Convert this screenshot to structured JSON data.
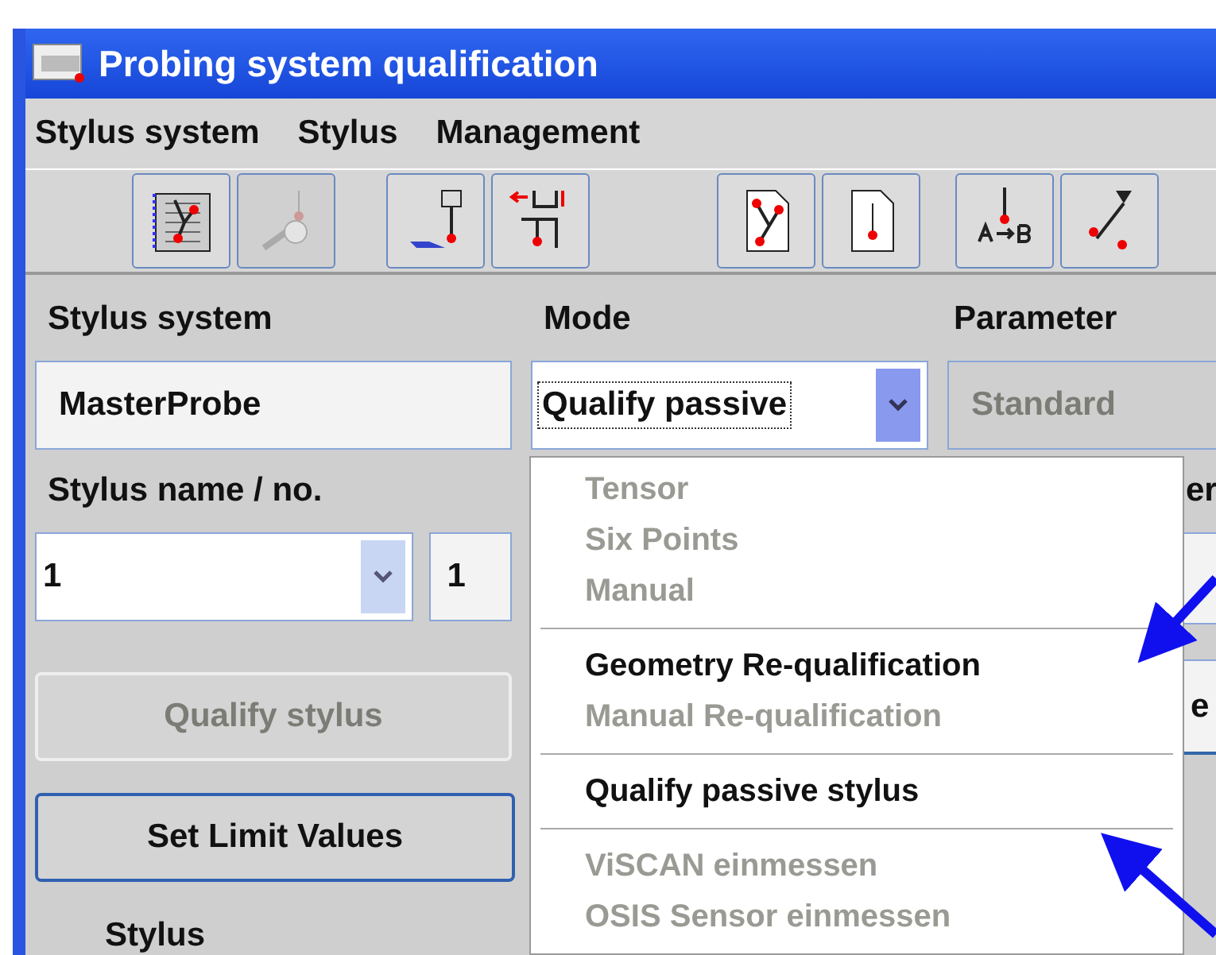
{
  "window": {
    "title": "Probing system qualification"
  },
  "menu": [
    "Stylus system",
    "Stylus",
    "Management"
  ],
  "toolbar": [
    {
      "kind": "stylus-board",
      "disabled": false
    },
    {
      "kind": "probe-ball",
      "disabled": true
    },
    {
      "kind": "hand-probe",
      "disabled": false
    },
    {
      "kind": "measure-probe",
      "disabled": false
    },
    {
      "kind": "page-multi",
      "disabled": false
    },
    {
      "kind": "page-single",
      "disabled": false
    },
    {
      "kind": "a-to-b",
      "disabled": false
    },
    {
      "kind": "tilt-probe",
      "disabled": false
    }
  ],
  "form": {
    "stylus_system": {
      "label": "Stylus system",
      "value": "MasterProbe"
    },
    "mode": {
      "label": "Mode",
      "value": "Qualify passive"
    },
    "parameter": {
      "label": "Parameter",
      "value": "Standard",
      "disabled": true
    },
    "stylus_name": {
      "label": "Stylus name / no.",
      "value": "1",
      "number": "1"
    },
    "column_3_label": "er",
    "column_3_button": "e",
    "stylus_label": "Stylus"
  },
  "mode_dropdown": [
    {
      "kind": "item",
      "label": "Tensor",
      "disabled": true
    },
    {
      "kind": "item",
      "label": "Six Points",
      "disabled": true
    },
    {
      "kind": "item",
      "label": "Manual",
      "disabled": true
    },
    {
      "kind": "separator"
    },
    {
      "kind": "item",
      "label": "Geometry Re-qualification",
      "disabled": false
    },
    {
      "kind": "item",
      "label": "Manual Re-qualification",
      "disabled": true
    },
    {
      "kind": "separator"
    },
    {
      "kind": "item",
      "label": "Qualify passive stylus",
      "disabled": false
    },
    {
      "kind": "separator"
    },
    {
      "kind": "item",
      "label": "ViSCAN einmessen",
      "disabled": true
    },
    {
      "kind": "item",
      "label": "OSIS Sensor einmessen",
      "disabled": true
    }
  ],
  "buttons": [
    {
      "label": "Qualify stylus",
      "disabled": true
    },
    {
      "label": "Set Limit Values",
      "disabled": false
    }
  ]
}
